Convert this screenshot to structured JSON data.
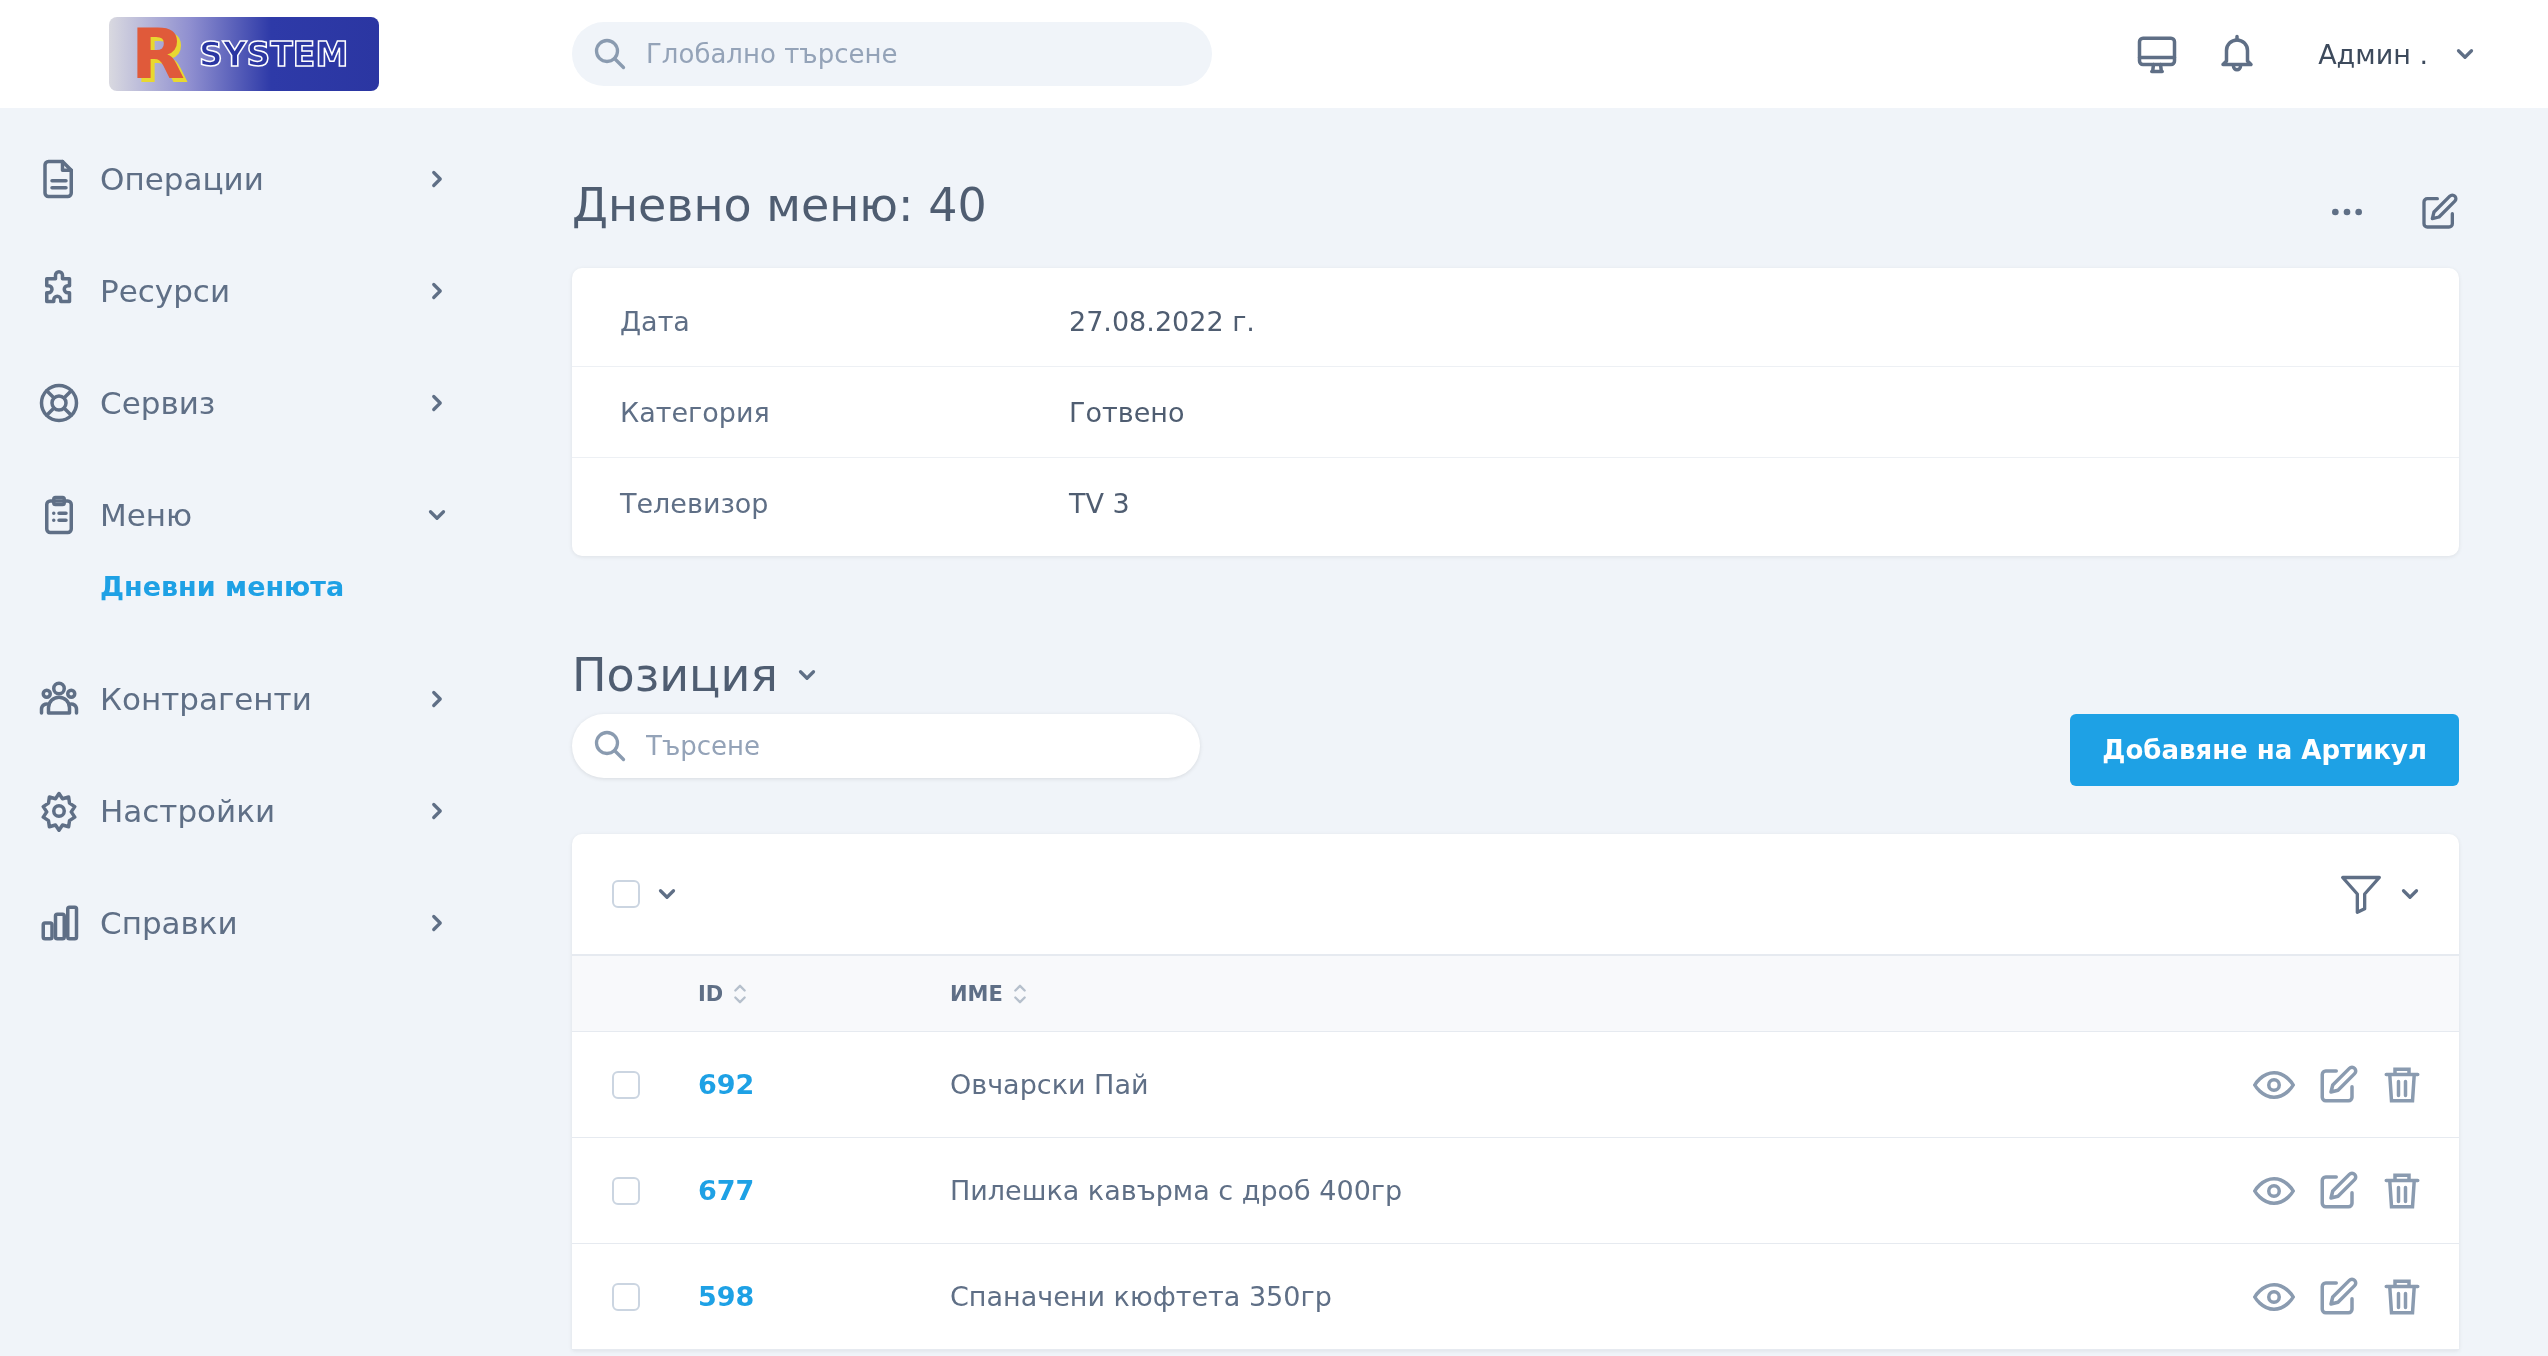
{
  "header": {
    "logo": {
      "letter": "R",
      "text": "SYSTEM"
    },
    "search": {
      "placeholder": "Глобално търсене"
    },
    "user": {
      "name": "Админ ."
    }
  },
  "sidebar": {
    "items": [
      {
        "label": "Операции",
        "expanded": false
      },
      {
        "label": "Ресурси",
        "expanded": false
      },
      {
        "label": "Сервиз",
        "expanded": false
      },
      {
        "label": "Меню",
        "expanded": true,
        "children": [
          {
            "label": "Дневни менюта",
            "selected": true
          }
        ]
      },
      {
        "label": "Контрагенти",
        "expanded": false
      },
      {
        "label": "Настройки",
        "expanded": false
      },
      {
        "label": "Справки",
        "expanded": false
      }
    ]
  },
  "page": {
    "title": "Дневно меню: 40"
  },
  "details": [
    {
      "label": "Дата",
      "value": "27.08.2022 г."
    },
    {
      "label": "Категория",
      "value": "Готвено"
    },
    {
      "label": "Телевизор",
      "value": "TV 3"
    }
  ],
  "positions": {
    "title": "Позиция",
    "expanded": true,
    "search": {
      "placeholder": "Търсене"
    },
    "add_button": "Добавяне на Артикул",
    "table": {
      "select_all": {
        "checked": false
      },
      "columns": [
        "ID",
        "ИМЕ"
      ],
      "rows": [
        {
          "id": "692",
          "name": "Овчарски Пай",
          "checked": false
        },
        {
          "id": "677",
          "name": "Пилешка кавърма с дроб 400гр",
          "checked": false
        },
        {
          "id": "598",
          "name": "Спаначени кюфтета 350гр",
          "checked": false
        }
      ]
    }
  }
}
